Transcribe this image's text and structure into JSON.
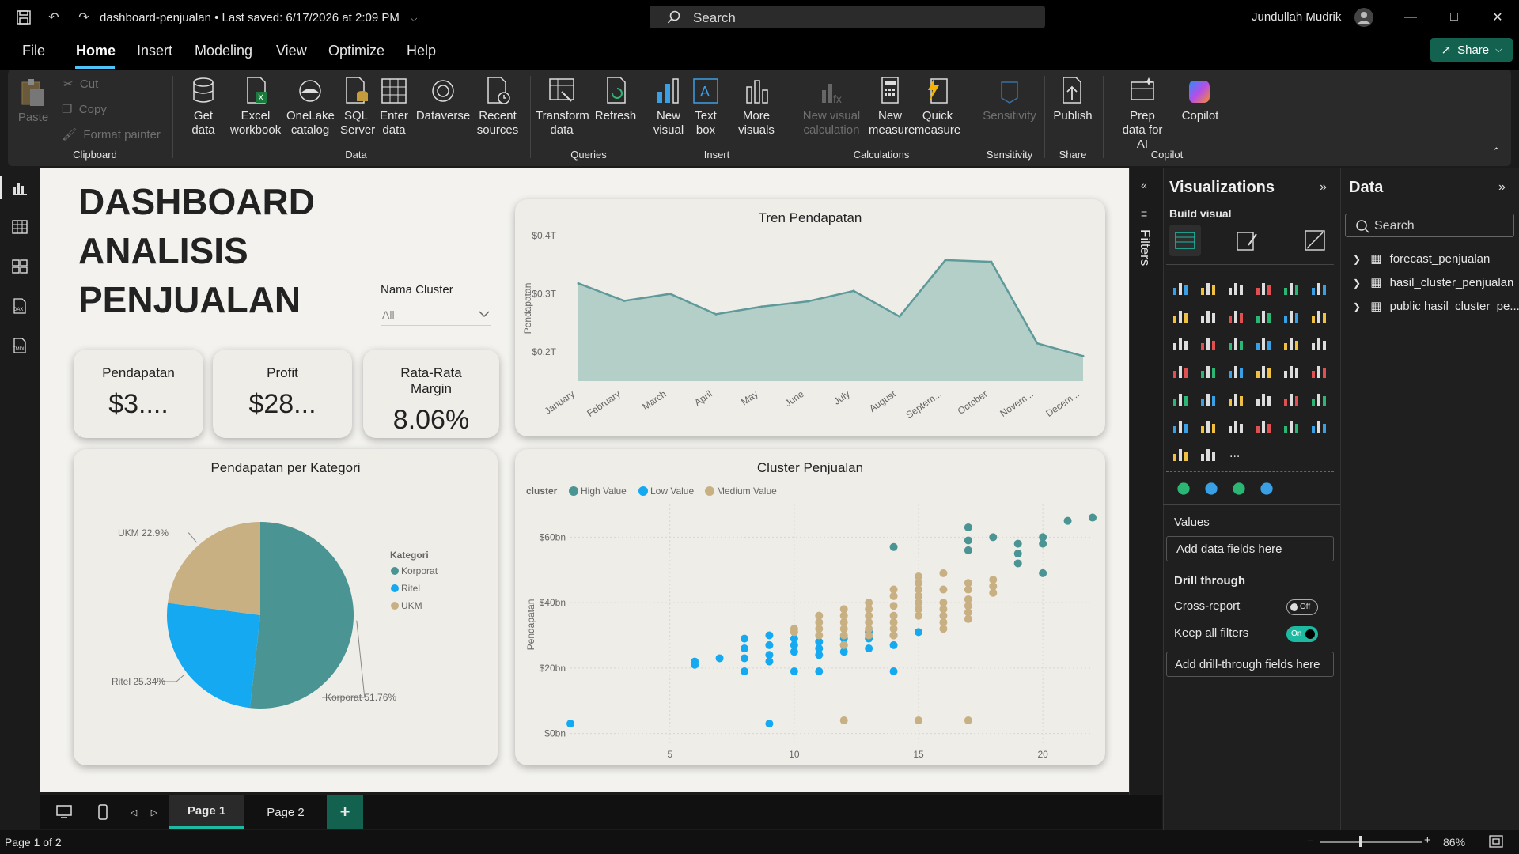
{
  "titlebar": {
    "doc_title": "dashboard-penjualan • Last saved: 6/17/2026 at 2:09 PM",
    "search_label": "Search",
    "user_name": "Jundullah Mudrik"
  },
  "menu": {
    "items": [
      "File",
      "Home",
      "Insert",
      "Modeling",
      "View",
      "Optimize",
      "Help"
    ],
    "active": "Home",
    "share_label": "Share"
  },
  "ribbon": {
    "clipboard": {
      "paste": "Paste",
      "cut": "Cut",
      "copy": "Copy",
      "format_painter": "Format painter",
      "label": "Clipboard"
    },
    "data": {
      "get_data": "Get data",
      "excel": "Excel workbook",
      "onelake": "OneLake catalog",
      "sql": "SQL Server",
      "enter": "Enter data",
      "dataverse": "Dataverse",
      "recent": "Recent sources",
      "label": "Data"
    },
    "queries": {
      "transform": "Transform data",
      "refresh": "Refresh",
      "label": "Queries"
    },
    "insert": {
      "new_visual": "New visual",
      "text_box": "Text box",
      "more_visuals": "More visuals",
      "label": "Insert"
    },
    "calculations": {
      "new_visual_calc": "New visual calculation",
      "new_measure": "New measure",
      "quick_measure": "Quick measure",
      "label": "Calculations"
    },
    "sensitivity": {
      "sensitivity": "Sensitivity",
      "label": "Sensitivity"
    },
    "share": {
      "publish": "Publish",
      "label": "Share"
    },
    "copilot": {
      "prep": "Prep data for AI",
      "copilot": "Copilot",
      "label": "Copilot"
    }
  },
  "canvas": {
    "title": "DASHBOARD ANALISIS PENJUALAN",
    "slicer_label": "Nama Cluster",
    "slicer_value": "All",
    "kpis": [
      {
        "label": "Pendapatan",
        "value": "$3...."
      },
      {
        "label": "Profit",
        "value": "$28..."
      },
      {
        "label": "Rata-Rata Margin",
        "value": "8.06%"
      }
    ]
  },
  "chart_data": [
    {
      "type": "area",
      "title": "Tren Pendapatan",
      "ylabel": "Pendapatan",
      "categories": [
        "January",
        "February",
        "March",
        "April",
        "May",
        "June",
        "July",
        "August",
        "Septem...",
        "October",
        "Novem...",
        "Decem..."
      ],
      "x_tick_labels": [
        "January",
        "February",
        "March",
        "April",
        "May",
        "June",
        "July",
        "August",
        "Septem...",
        "October",
        "Novem...",
        "Decem..."
      ],
      "values": [
        0.318,
        0.288,
        0.3,
        0.265,
        0.278,
        0.287,
        0.305,
        0.261,
        0.358,
        0.355,
        0.215,
        0.193
      ],
      "y_ticks": [
        "$0.2T",
        "$0.3T",
        "$0.4T"
      ],
      "y_tick_values": [
        0.2,
        0.3,
        0.4
      ],
      "ylim": [
        0.15,
        0.4
      ],
      "color": "#5e9a9a"
    },
    {
      "type": "pie",
      "title": "Pendapatan per Kategori",
      "legend_title": "Kategori",
      "slices": [
        {
          "name": "Korporat",
          "value": 51.76,
          "label": "Korporat 51.76%",
          "color": "#4a9494"
        },
        {
          "name": "Ritel",
          "value": 25.34,
          "label": "Ritel 25.34%",
          "color": "#14a9f1"
        },
        {
          "name": "UKM",
          "value": 22.9,
          "label": "UKM 22.9%",
          "color": "#c8b083"
        }
      ]
    },
    {
      "type": "scatter",
      "title": "Cluster Penjualan",
      "legend_title": "cluster",
      "xlabel": "Jumlah Transaksi",
      "ylabel": "Pendapatan",
      "x_ticks": [
        5,
        10,
        15,
        20
      ],
      "x_tick_labels": [
        "5",
        "10",
        "15",
        "20"
      ],
      "y_ticks": [
        0,
        20,
        40,
        60
      ],
      "y_tick_labels": [
        "$0bn",
        "$20bn",
        "$40bn",
        "$60bn"
      ],
      "xlim": [
        1,
        22
      ],
      "ylim": [
        -3,
        70
      ],
      "series": [
        {
          "name": "High Value",
          "color": "#4a9494",
          "points": [
            [
              14,
              57
            ],
            [
              17,
              63
            ],
            [
              17,
              59
            ],
            [
              17,
              56
            ],
            [
              18,
              60
            ],
            [
              19,
              58
            ],
            [
              19,
              55
            ],
            [
              19,
              52
            ],
            [
              20,
              60
            ],
            [
              20,
              58
            ],
            [
              20,
              49
            ],
            [
              21,
              65
            ],
            [
              22,
              66
            ]
          ]
        },
        {
          "name": "Low Value",
          "color": "#14a9f1",
          "points": [
            [
              1,
              3
            ],
            [
              6,
              21
            ],
            [
              6,
              22
            ],
            [
              7,
              23
            ],
            [
              8,
              29
            ],
            [
              8,
              26
            ],
            [
              8,
              23
            ],
            [
              8,
              19
            ],
            [
              9,
              30
            ],
            [
              9,
              27
            ],
            [
              9,
              24
            ],
            [
              9,
              22
            ],
            [
              9,
              3
            ],
            [
              10,
              29
            ],
            [
              10,
              27
            ],
            [
              10,
              25
            ],
            [
              10,
              19
            ],
            [
              11,
              28
            ],
            [
              11,
              26
            ],
            [
              11,
              24
            ],
            [
              11,
              19
            ],
            [
              12,
              29
            ],
            [
              12,
              27
            ],
            [
              12,
              25
            ],
            [
              13,
              31
            ],
            [
              13,
              29
            ],
            [
              13,
              26
            ],
            [
              14,
              30
            ],
            [
              14,
              27
            ],
            [
              14,
              19
            ],
            [
              15,
              31
            ]
          ]
        },
        {
          "name": "Medium Value",
          "color": "#c8b083",
          "points": [
            [
              10,
              32
            ],
            [
              10,
              31
            ],
            [
              11,
              36
            ],
            [
              11,
              34
            ],
            [
              11,
              32
            ],
            [
              11,
              30
            ],
            [
              12,
              38
            ],
            [
              12,
              36
            ],
            [
              12,
              34
            ],
            [
              12,
              32
            ],
            [
              12,
              30
            ],
            [
              12,
              27
            ],
            [
              12,
              4
            ],
            [
              13,
              40
            ],
            [
              13,
              38
            ],
            [
              13,
              36
            ],
            [
              13,
              34
            ],
            [
              13,
              32
            ],
            [
              13,
              30
            ],
            [
              14,
              44
            ],
            [
              14,
              42
            ],
            [
              14,
              39
            ],
            [
              14,
              36
            ],
            [
              14,
              34
            ],
            [
              14,
              32
            ],
            [
              14,
              30
            ],
            [
              15,
              48
            ],
            [
              15,
              46
            ],
            [
              15,
              44
            ],
            [
              15,
              42
            ],
            [
              15,
              40
            ],
            [
              15,
              38
            ],
            [
              15,
              36
            ],
            [
              15,
              4
            ],
            [
              16,
              49
            ],
            [
              16,
              44
            ],
            [
              16,
              40
            ],
            [
              16,
              38
            ],
            [
              16,
              36
            ],
            [
              16,
              34
            ],
            [
              16,
              32
            ],
            [
              17,
              46
            ],
            [
              17,
              44
            ],
            [
              17,
              41
            ],
            [
              17,
              39
            ],
            [
              17,
              37
            ],
            [
              17,
              35
            ],
            [
              17,
              4
            ],
            [
              18,
              47
            ],
            [
              18,
              45
            ],
            [
              18,
              43
            ]
          ]
        }
      ]
    }
  ],
  "pages": {
    "tabs": [
      "Page 1",
      "Page 2"
    ],
    "active": "Page 1",
    "add": "+",
    "status": "Page 1 of 2",
    "zoom": "86%"
  },
  "filters": {
    "label": "Filters"
  },
  "viz_pane": {
    "title": "Visualizations",
    "build_visual": "Build visual",
    "values_label": "Values",
    "values_placeholder": "Add data fields here",
    "drill_label": "Drill through",
    "cross_report": "Cross-report",
    "cross_report_state": "Off",
    "keep_filters": "Keep all filters",
    "keep_filters_state": "On",
    "drill_placeholder": "Add drill-through fields here",
    "more": "..."
  },
  "data_pane": {
    "title": "Data",
    "search_placeholder": "Search",
    "tables": [
      "forecast_penjualan",
      "hasil_cluster_penjualan",
      "public hasil_cluster_pe..."
    ]
  },
  "colors": {
    "accent": "#4fc3f7",
    "share": "#12624f",
    "toggle_on": "#1db9a1"
  }
}
